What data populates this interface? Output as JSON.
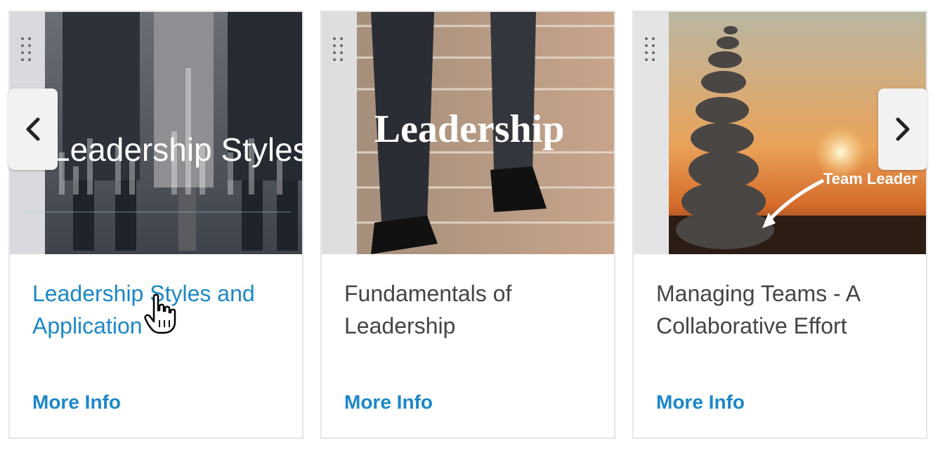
{
  "cards": [
    {
      "title": "Leadership Styles and Application",
      "image_text": "Leadership Styles",
      "more_info": "More Info"
    },
    {
      "title": "Fundamentals of Leadership",
      "image_text": "Leadership",
      "more_info": "More Info"
    },
    {
      "title": "Managing Teams - A Collaborative Effort",
      "image_text": "Team Leader",
      "more_info": "More Info"
    }
  ],
  "nav": {
    "prev_icon": "chevron-left-icon",
    "next_icon": "chevron-right-icon"
  },
  "colors": {
    "link": "#1b87c9",
    "title_text": "#444444",
    "border": "#e6e6e6"
  }
}
